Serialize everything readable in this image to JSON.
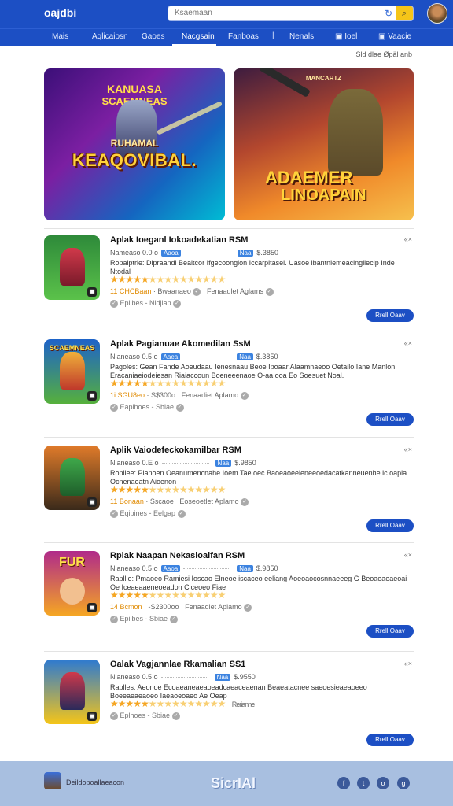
{
  "header": {
    "logo": "oajdbi",
    "search_placeholder": "Ksaemaan",
    "search_button_icon": "search-icon",
    "refresh_icon": "refresh-icon",
    "avatar_icon": "user-avatar"
  },
  "nav": {
    "items": [
      {
        "label": "Mais"
      },
      {
        "label": "Aqlicaiosn"
      },
      {
        "label": "Gaoes"
      },
      {
        "label": "Nacgsain"
      },
      {
        "label": "Fanboas"
      },
      {
        "label": "Nenals"
      },
      {
        "label": "Ioel"
      },
      {
        "label": "Vaacie"
      }
    ],
    "active_index": 3
  },
  "meta_line": "Sld dlae Øpäl anb",
  "banners": [
    {
      "top": "KANUASA",
      "sub": "SCAEMNEAS",
      "label": "RUHAMAL",
      "title": "KEAQOVIBAL."
    },
    {
      "top": "MANCARTZ",
      "title": "ADAEMER",
      "title2": "LINOAPAIN"
    }
  ],
  "apps": [
    {
      "title": "Aplak Ioeganl Iokoadekatian RSM",
      "info": "Nameaso 0.0 o",
      "tag": "Aaoa",
      "tag2": "Naa",
      "size": "$.3850",
      "desc": "Ropaiptrie: Dipraandi Beaitcor Ifgecoongion Iccarpitasei. Uasoe ibantniemeacingliecip Inde Ntodal",
      "rating": 4,
      "extra_a": "11 CHCBaan",
      "extra_b": "Bwaanaeo",
      "extra_c": "Fenaadlet Aglams",
      "footer": "Epilbes - Nidjiap",
      "more": "«×",
      "button": "Rrell   Oaav",
      "icon_text": ""
    },
    {
      "title": "Aplak Pagianuae Akomedilan SsM",
      "info": "Nianeaso 0.5 o",
      "tag": "Aaea",
      "tag2": "Naa",
      "size": "$.3850",
      "desc": "Pagoles: Gean Fande Aoeudaau Ienesnaau Beoe Ipoaar Alaamnaeoo Oetailo Iane Manlon Eracaniaeiodeiesan Riaiaccoun Boeneeenaoe O-aa ooa Eo Soesuet Noal.",
      "rating": 4,
      "extra_a": "1i SGU8eo",
      "extra_b": "S$300o",
      "extra_c": "Fenaadiet Aplamo",
      "footer": "Eaplhoes - Sbiae",
      "more": "«×",
      "button": "Rrell   Oaav",
      "icon_text": "SCAEMNEAS"
    },
    {
      "title": "Aplik Vaiodefeckokamilbar RSM",
      "info": "Nianeaso 0.E o",
      "tag": "Naa",
      "tag2": "Naa",
      "size": "$.9850",
      "desc": "Ropliee: Pianoen Oeanumencnahe Ioem Tae oec Baoeaoeeieneeoedacatkanneuenhe ic oapla Ocnenaeatn Aioenon",
      "rating": 4,
      "extra_a": "11 Bonaan",
      "extra_b": "Sscaoe",
      "extra_c": "Eoseoetlet Aplamo",
      "footer": "Eqipines - Eelgap",
      "more": "«×",
      "button": "Rrell   Oaav",
      "icon_text": ""
    },
    {
      "title": "Rplak Naapan Nekasioalfan RSM",
      "info": "Nianeaso 0.5 o",
      "tag": "Aaoa",
      "tag2": "Naa",
      "size": "$.9850",
      "desc": "Rapllie: Pmaoeo Ramiesi Ioscao Elneoe iscaceo eeliang Aoeoaocosnnaeeeg G Beoaeaeaeoai Oe Iceaeaaeneoeadon Ciceoeo Fiae",
      "rating": 4,
      "extra_a": "14 Bcmon",
      "extra_b": "-S2300oo",
      "extra_c": "Fenaadiet Aplamo",
      "footer": "Epilbes - Sbiae",
      "more": "«×",
      "button": "Rrell   Oaav",
      "icon_text": "FUR"
    },
    {
      "title": "Oalak Vagjannlae Rkamalian SS1",
      "info": "Nianeaso 0.5 o",
      "tag": "Naa",
      "tag2": "Naa",
      "size": "$.9550",
      "desc": "Raplles: Aeonoe Ecoaeaneaeaoeadcaeaceaenan Beaeatacnee saeoesieaeaoeeo Boeeaeaeaoeo Iaeaoeoaeo Ae Oeap",
      "rating": 4,
      "extra_a": "",
      "extra_b": "",
      "extra_c": "Rerianne",
      "footer": "Eplhoes - Sbiae",
      "more": "«×",
      "button": "Rrell   Oaav",
      "icon_text": ""
    }
  ],
  "footer": {
    "text": "Deildopoallaeacon",
    "brand": "SicrIAl",
    "social": [
      "f",
      "t",
      "o",
      "g"
    ]
  },
  "colors": {
    "primary": "#1c4fc4",
    "accent": "#f5c518",
    "star": "#f5a623",
    "footer_bg": "#a8bfe0"
  }
}
